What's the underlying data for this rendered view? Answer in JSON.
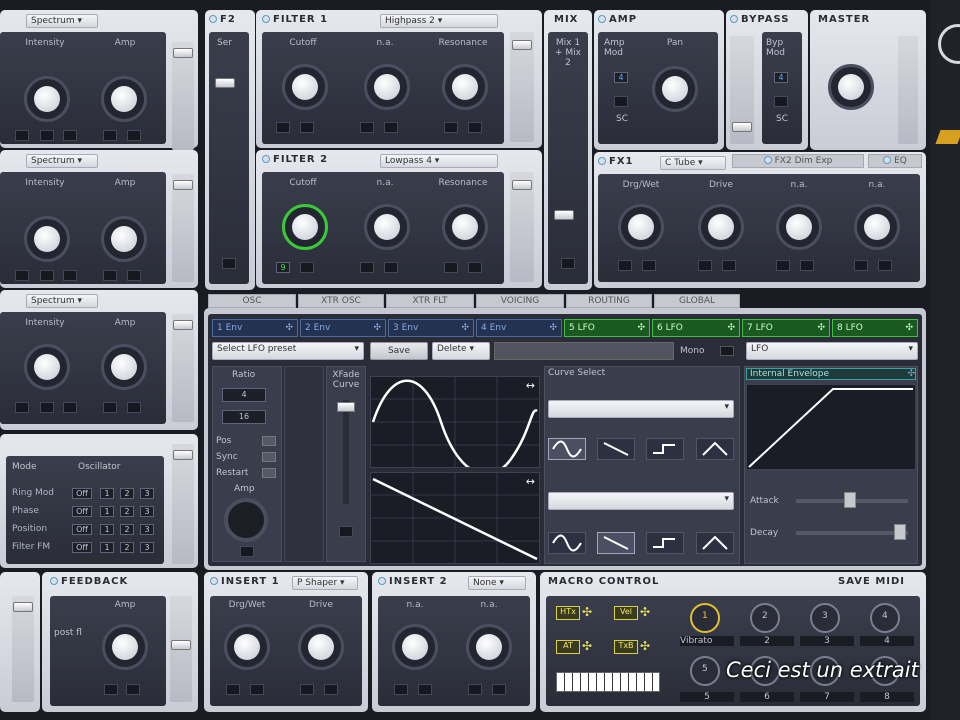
{
  "osc_column": {
    "rows": [
      {
        "spectrum": "Spectrum",
        "knob1": "Intensity",
        "knob2": "Amp"
      },
      {
        "spectrum": "Spectrum",
        "knob1": "Intensity",
        "knob2": "Amp"
      },
      {
        "spectrum": "Spectrum",
        "knob1": "Intensity",
        "knob2": "Amp"
      }
    ],
    "mod_headers": [
      "Mode",
      "Oscillator"
    ],
    "mod_rows": [
      "Ring Mod",
      "Phase",
      "Position",
      "Filter FM"
    ],
    "mod_off": "Off",
    "mod_nums": [
      "1",
      "2",
      "3"
    ]
  },
  "f2": {
    "title": "F2",
    "label": "Ser"
  },
  "filter1": {
    "title": "FILTER 1",
    "type": "Highpass 2",
    "knobs": [
      "Cutoff",
      "n.a.",
      "Resonance"
    ]
  },
  "filter2": {
    "title": "FILTER 2",
    "type": "Lowpass 4",
    "knobs": [
      "Cutoff",
      "n.a.",
      "Resonance"
    ],
    "badge": "9"
  },
  "mix": {
    "title": "MIX",
    "label": "Mix 1 + Mix 2"
  },
  "amp": {
    "title": "AMP",
    "mod": "Amp Mod",
    "knob": "Pan",
    "mod_value": "4",
    "sc": "SC"
  },
  "bypass": {
    "title": "BYPASS",
    "mod": "Byp Mod",
    "mod_value": "4",
    "sc": "SC"
  },
  "master": {
    "title": "MASTER"
  },
  "fx": {
    "fx1": "FX1",
    "fx1_type": "C Tube",
    "fx2": "FX2",
    "fx2_type": "Dim Exp",
    "eq": "EQ",
    "knobs": [
      "Drg/Wet",
      "Drive",
      "n.a.",
      "n.a."
    ]
  },
  "tabs": [
    "OSC",
    "XTR OSC",
    "XTR FLT",
    "VOICING",
    "ROUTING",
    "GLOBAL"
  ],
  "mod_tabs": [
    {
      "label": "1 Env",
      "active": false
    },
    {
      "label": "2 Env",
      "active": false
    },
    {
      "label": "3 Env",
      "active": false
    },
    {
      "label": "4 Env",
      "active": false
    },
    {
      "label": "5 LFO",
      "active": true
    },
    {
      "label": "6 LFO",
      "active": true
    },
    {
      "label": "7 LFO",
      "active": true
    },
    {
      "label": "8 LFO",
      "active": true
    }
  ],
  "lfo": {
    "preset": "Select LFO preset",
    "save": "Save",
    "delete": "Delete",
    "mono": "Mono",
    "type": "LFO",
    "ratio": "Ratio",
    "ratio_top": "4",
    "ratio_bottom": "16",
    "xfade": "XFade Curve",
    "pos": "Pos",
    "sync": "Sync",
    "restart": "Restart",
    "amp": "Amp",
    "curve_select": "Curve Select",
    "internal_env": "Internal Envelope",
    "attack": "Attack",
    "decay": "Decay"
  },
  "feedback": {
    "title": "FEEDBACK",
    "knob": "Amp",
    "label": "post fl"
  },
  "insert1": {
    "title": "INSERT 1",
    "type": "P Shaper",
    "knobs": [
      "Drg/Wet",
      "Drive"
    ]
  },
  "insert2": {
    "title": "INSERT 2",
    "type": "None",
    "knobs": [
      "n.a.",
      "n.a."
    ]
  },
  "macro": {
    "title": "MACRO CONTROL",
    "save_midi": "SAVE MIDI",
    "buttons": [
      "HTx",
      "Vel",
      "AT",
      "TxB"
    ],
    "slots": [
      {
        "num": "1",
        "label": "Vibrato"
      },
      {
        "num": "2",
        "label": "2"
      },
      {
        "num": "3",
        "label": "3"
      },
      {
        "num": "4",
        "label": "4"
      },
      {
        "num": "5",
        "label": "5"
      },
      {
        "num": "6",
        "label": "6"
      },
      {
        "num": "7",
        "label": "7"
      },
      {
        "num": "8",
        "label": "8"
      }
    ]
  },
  "overlay": {
    "caption": "Ceci est un extrait"
  }
}
